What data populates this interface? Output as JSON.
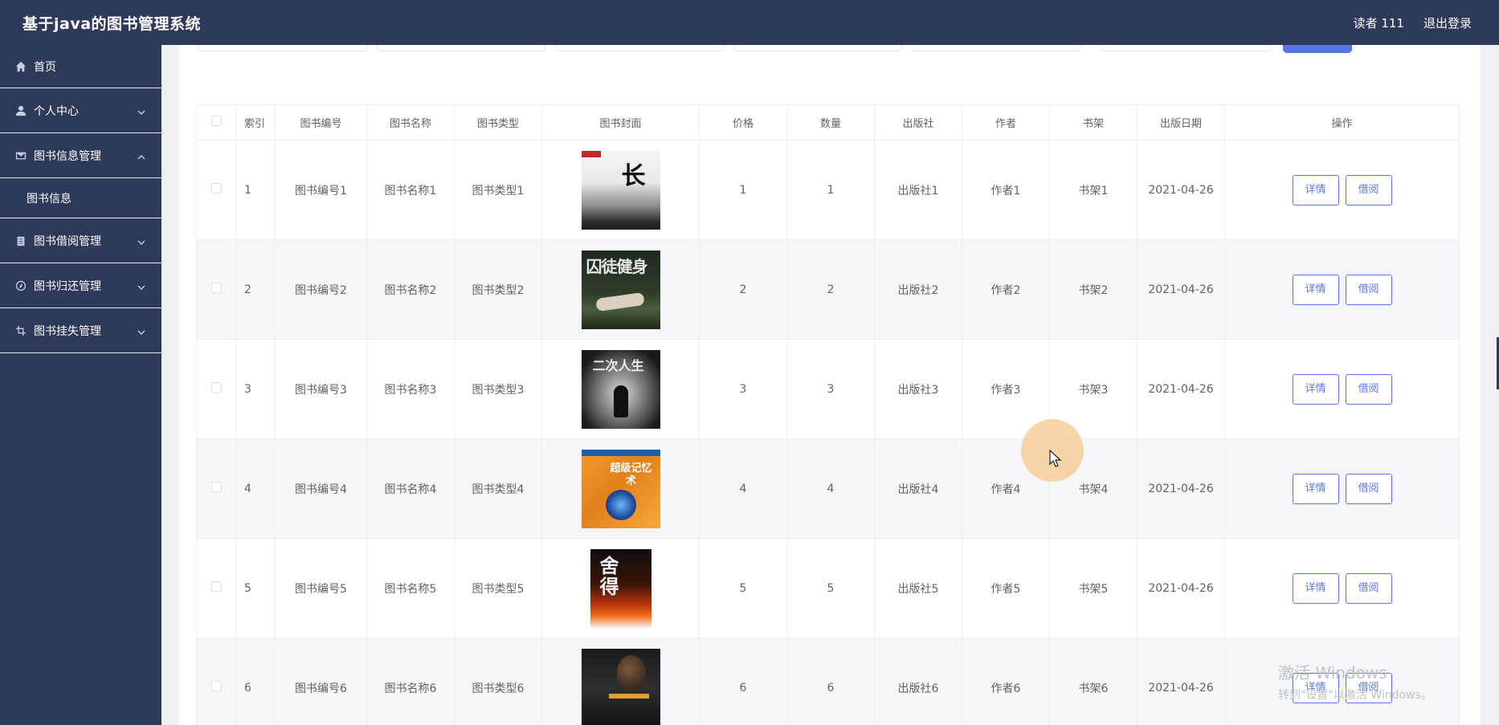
{
  "header": {
    "app_title": "基于java的图书管理系统",
    "user": "读者 111",
    "logout": "退出登录"
  },
  "sidebar": {
    "items": [
      {
        "label": "首页",
        "icon": "home-icon"
      },
      {
        "label": "个人中心",
        "icon": "user-icon"
      },
      {
        "label": "图书信息管理",
        "icon": "mail-icon"
      },
      {
        "label": "图书信息",
        "icon": ""
      },
      {
        "label": "图书借阅管理",
        "icon": "clipboard-icon"
      },
      {
        "label": "图书归还管理",
        "icon": "compass-icon"
      },
      {
        "label": "图书挂失管理",
        "icon": "crop-icon"
      }
    ]
  },
  "table": {
    "headers": [
      "索引",
      "图书编号",
      "图书名称",
      "图书类型",
      "图书封面",
      "价格",
      "数量",
      "出版社",
      "作者",
      "书架",
      "出版日期",
      "操作"
    ],
    "rows": [
      {
        "idx": "1",
        "code": "图书编号1",
        "name": "图书名称1",
        "type": "图书类型1",
        "cover_text": "长",
        "price": "1",
        "qty": "1",
        "publisher": "出版社1",
        "author": "作者1",
        "shelf": "书架1",
        "date": "2021-04-26"
      },
      {
        "idx": "2",
        "code": "图书编号2",
        "name": "图书名称2",
        "type": "图书类型2",
        "cover_text": "囚徒健身",
        "price": "2",
        "qty": "2",
        "publisher": "出版社2",
        "author": "作者2",
        "shelf": "书架2",
        "date": "2021-04-26"
      },
      {
        "idx": "3",
        "code": "图书编号3",
        "name": "图书名称3",
        "type": "图书类型3",
        "cover_text": "二次人生",
        "price": "3",
        "qty": "3",
        "publisher": "出版社3",
        "author": "作者3",
        "shelf": "书架3",
        "date": "2021-04-26"
      },
      {
        "idx": "4",
        "code": "图书编号4",
        "name": "图书名称4",
        "type": "图书类型4",
        "cover_text": "超级记忆术",
        "price": "4",
        "qty": "4",
        "publisher": "出版社4",
        "author": "作者4",
        "shelf": "书架4",
        "date": "2021-04-26"
      },
      {
        "idx": "5",
        "code": "图书编号5",
        "name": "图书名称5",
        "type": "图书类型5",
        "cover_text": "舍得",
        "price": "5",
        "qty": "5",
        "publisher": "出版社5",
        "author": "作者5",
        "shelf": "书架5",
        "date": "2021-04-26"
      },
      {
        "idx": "6",
        "code": "图书编号6",
        "name": "图书名称6",
        "type": "图书类型6",
        "cover_text": "",
        "price": "6",
        "qty": "6",
        "publisher": "出版社6",
        "author": "作者6",
        "shelf": "书架6",
        "date": "2021-04-26"
      }
    ],
    "actions": {
      "detail": "详情",
      "borrow": "借阅"
    }
  },
  "watermark": {
    "title": "激活 Windows",
    "subtitle": "转到\"设置\"以激活 Windows。"
  }
}
